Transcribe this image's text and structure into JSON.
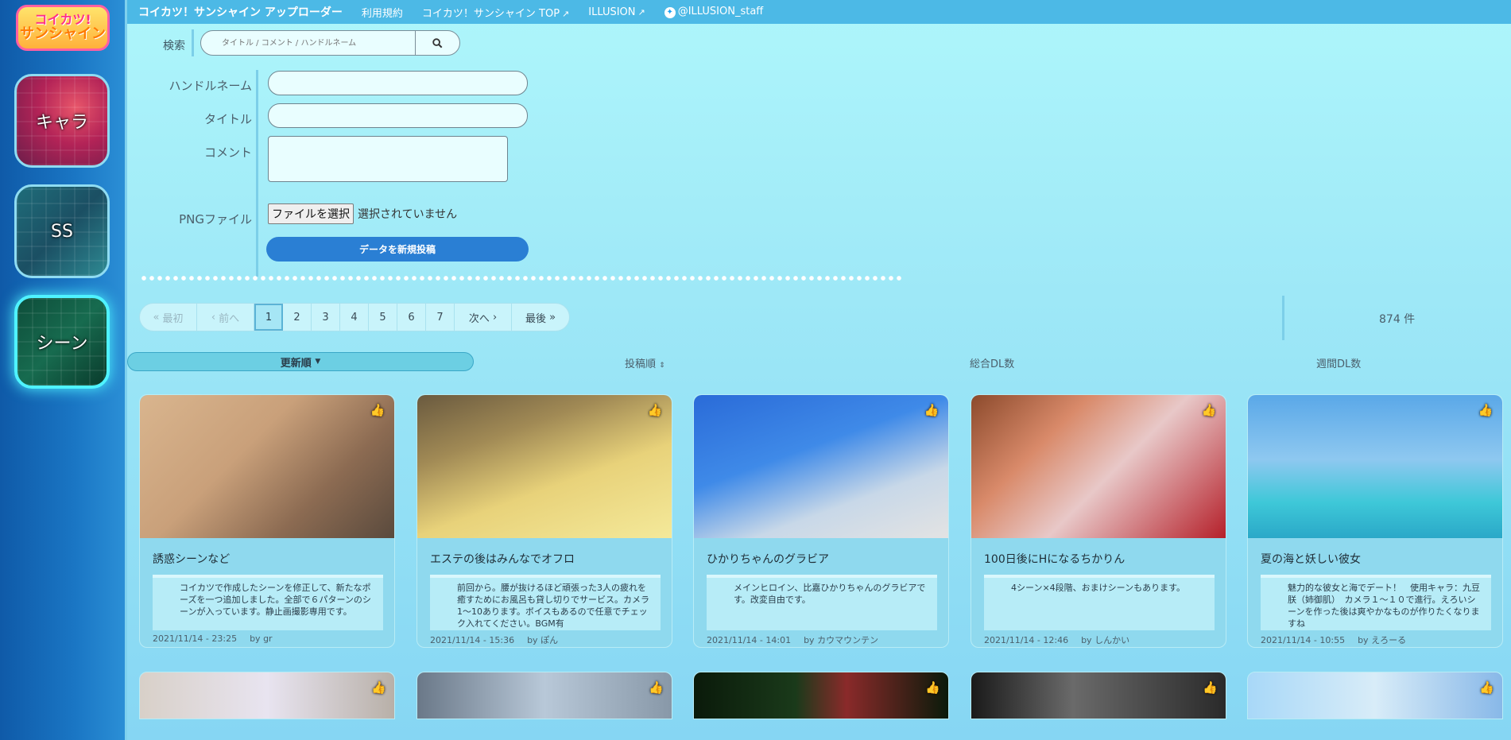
{
  "logo": {
    "line1": "コイカツ!",
    "line2": "サンシャイン"
  },
  "sidebar": {
    "items": [
      {
        "label": "キャラ"
      },
      {
        "label": "SS"
      },
      {
        "label": "シーン"
      }
    ]
  },
  "topnav": {
    "brand": "コイカツ！サンシャイン アップローダー",
    "terms": "利用規約",
    "top": "コイカツ！サンシャイン TOP",
    "illusion": "ILLUSION",
    "twitter": "@ILLUSION_staff"
  },
  "search": {
    "label": "検索",
    "placeholder": "タイトル / コメント / ハンドルネーム"
  },
  "form": {
    "handle_label": "ハンドルネーム",
    "title_label": "タイトル",
    "comment_label": "コメント",
    "png_label": "PNGファイル",
    "file_button": "ファイルを選択",
    "file_status": "選択されていません",
    "submit": "データを新規投稿"
  },
  "pagination": {
    "first": "最初",
    "prev": "前へ",
    "pages": [
      "1",
      "2",
      "3",
      "4",
      "5",
      "6",
      "7"
    ],
    "current": "1",
    "next": "次へ",
    "last": "最後"
  },
  "total": "874 件",
  "sort": {
    "updated": "更新順",
    "posted": "投稿順",
    "total_dl": "総合DL数",
    "weekly_dl": "週間DL数"
  },
  "cards": [
    {
      "title": "誘惑シーンなど",
      "desc": "コイカツで作成したシーンを修正して、新たなポーズを一つ追加しました。全部で６パターンのシーンが入っています。静止画撮影専用です。",
      "date": "2021/11/14 - 23:25",
      "by": "by gr"
    },
    {
      "title": "エステの後はみんなでオフロ",
      "desc": "前回から。腰が抜けるほど頑張った3人の疲れを癒すためにお風呂も貸し切りでサービス。カメラ1〜10あります。ボイスもあるので任意でチェック入れてください。BGM有",
      "date": "2021/11/14 - 15:36",
      "by": "by ぽん"
    },
    {
      "title": "ひかりちゃんのグラビア",
      "desc": "メインヒロイン、比嘉ひかりちゃんのグラビアです。改変自由です。",
      "date": "2021/11/14 - 14:01",
      "by": "by カウマウンテン"
    },
    {
      "title": "100日後にHになるちかりん",
      "desc": "4シーン×4段階、おまけシーンもあります。",
      "date": "2021/11/14 - 12:46",
      "by": "by しんかい"
    },
    {
      "title": "夏の海と妖しい彼女",
      "desc": "魅力的な彼女と海でデート！　使用キャラ：九豆 朕（姉御肌）　カメラ１〜１０で進行。えろいシーンを作った後は爽やかなものが作りたくなりますね",
      "date": "2021/11/14 - 10:55",
      "by": "by えろーる"
    }
  ],
  "icons": {
    "like": "thumbs-up-icon",
    "search": "search-icon",
    "external": "external-link-icon",
    "twitter": "twitter-icon"
  }
}
